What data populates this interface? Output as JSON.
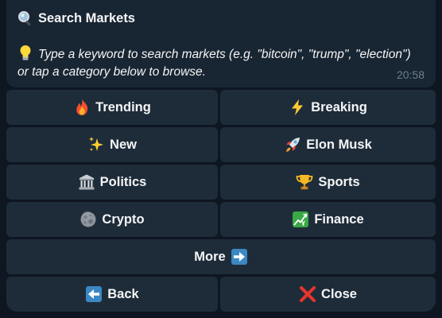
{
  "message": {
    "title": "Search Markets",
    "title_icon": "magnifier-icon",
    "hint": "Type a keyword to search markets (e.g. \"bitcoin\", \"trump\", \"election\") or tap a category below to browse.",
    "hint_icon": "lightbulb-icon",
    "time": "20:58"
  },
  "keyboard": {
    "trending": "Trending",
    "breaking": "Breaking",
    "new": "New",
    "elon": "Elon Musk",
    "politics": "Politics",
    "sports": "Sports",
    "crypto": "Crypto",
    "finance": "Finance",
    "more": "More",
    "back": "Back",
    "close": "Close"
  },
  "colors": {
    "background": "#0e1621",
    "bubble": "#182533",
    "button": "#1e2c3a",
    "timestamp": "#6d7f8f"
  }
}
